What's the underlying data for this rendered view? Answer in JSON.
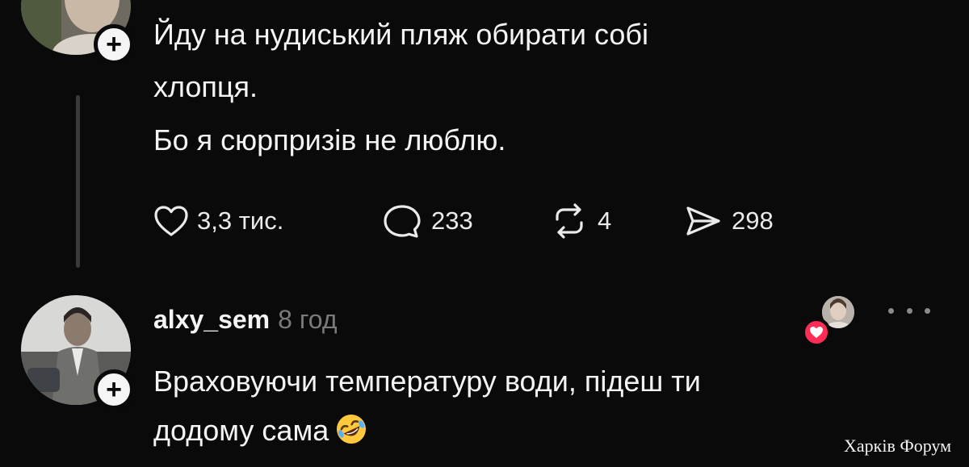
{
  "post": {
    "lines": [
      "Йду на нудиський пляж обирати собі",
      "хлопця.",
      "Бо я сюрпризів не люблю."
    ],
    "actions": {
      "likes": "3,3 тис.",
      "comments": "233",
      "reposts": "4",
      "shares": "298"
    }
  },
  "reply": {
    "username": "alxy_sem",
    "time": "8 год",
    "lines": [
      "Враховуючи температуру води, підеш ти",
      "додому сама"
    ],
    "emoji": "rolling-on-floor-laughing-emoji"
  },
  "watermark": "Харків Форум",
  "colors": {
    "background": "#0a0a0a",
    "text": "#f4f4f4",
    "muted": "#7a7a7a",
    "heart": "#ff2d55"
  }
}
